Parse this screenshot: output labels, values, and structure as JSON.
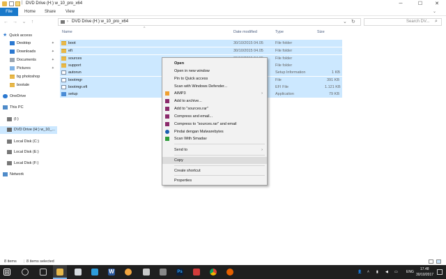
{
  "window": {
    "title": "DVD Drive (H:) w_10_pro_x64",
    "title_prefix": "|",
    "controls": [
      "─",
      "☐",
      "✕"
    ]
  },
  "ribbon": {
    "file_tab": "File",
    "tabs": [
      "Home",
      "Share",
      "View"
    ]
  },
  "address": {
    "path": "DVD Drive (H:) w_10_pro_x64",
    "search_placeholder": "Search DV..."
  },
  "nav": {
    "items": [
      {
        "label": "Quick access"
      },
      {
        "label": "Desktop",
        "pinned": true
      },
      {
        "label": "Downloads",
        "pinned": true
      },
      {
        "label": "Documents",
        "pinned": true
      },
      {
        "label": "Pictures",
        "pinned": true
      },
      {
        "label": "bg photoshop"
      },
      {
        "label": "bootale"
      },
      {
        "label": "OneDrive"
      },
      {
        "label": "This PC"
      },
      {
        "label": "(I:)"
      },
      {
        "label": "DVD Drive (H:) w_10_..."
      },
      {
        "label": "Local Disk (C:)"
      },
      {
        "label": "Local Disk (E:)"
      },
      {
        "label": "Local Disk (F:)"
      },
      {
        "label": "Network"
      }
    ]
  },
  "columns": {
    "name": "Name",
    "date": "Date modified",
    "type": "Type",
    "size": "Size"
  },
  "files": [
    {
      "name": "boot",
      "date": "30/10/2015 04.05",
      "type": "File folder",
      "size": "",
      "kind": "folder"
    },
    {
      "name": "efi",
      "date": "30/10/2015 04.05",
      "type": "File folder",
      "size": "",
      "kind": "folder"
    },
    {
      "name": "sources",
      "date": "30/10/2015 04.05",
      "type": "File folder",
      "size": "",
      "kind": "folder"
    },
    {
      "name": "support",
      "date": "",
      "type": "File folder",
      "size": "",
      "kind": "folder"
    },
    {
      "name": "autorun",
      "date": "",
      "type": "Setup Information",
      "size": "1 KB",
      "kind": "doc"
    },
    {
      "name": "bootmgr",
      "date": "",
      "type": "File",
      "size": "391 KB",
      "kind": "doc"
    },
    {
      "name": "bootmgr.efi",
      "date": "",
      "type": "EFI File",
      "size": "1.121 KB",
      "kind": "doc"
    },
    {
      "name": "setup",
      "date": "",
      "type": "Application",
      "size": "79 KB",
      "kind": "app"
    }
  ],
  "context_menu": {
    "items": [
      {
        "label": "Open",
        "bold": true
      },
      {
        "label": "Open in new window"
      },
      {
        "label": "Pin to Quick access"
      },
      {
        "label": "Scan with Windows Defender..."
      },
      {
        "label": "AIMP3",
        "submenu": true,
        "icon": "aimp-icon"
      },
      {
        "label": "Add to archive...",
        "icon": "winrar-icon"
      },
      {
        "label": "Add to \"sources.rar\"",
        "icon": "winrar-icon"
      },
      {
        "label": "Compress and email...",
        "icon": "winrar-icon"
      },
      {
        "label": "Compress to \"sources.rar\" and email",
        "icon": "winrar-icon"
      },
      {
        "label": "Pindai dengan Malwarebytes",
        "icon": "malwarebytes-icon"
      },
      {
        "label": "Scan With Smadav",
        "icon": "smadav-icon"
      },
      {
        "label": "Send to",
        "submenu": true
      },
      {
        "label": "Copy",
        "highlighted": true
      },
      {
        "label": "Create shortcut"
      },
      {
        "label": "Properties"
      }
    ]
  },
  "status": {
    "count": "8 items",
    "selected": "8 items selected"
  },
  "taskbar": {
    "apps": [
      "start-icon",
      "search-icon",
      "file-explorer-icon",
      "app-icon",
      "word-icon",
      "paint-icon",
      "app-icon-2",
      "photoshop-icon",
      "app-icon-3",
      "chrome-icon",
      "firefox-icon"
    ],
    "lang": "ENG",
    "time": "17.48",
    "date": "30/10/2017"
  },
  "colors": {
    "accent": "#1979ca",
    "selection": "#cce8ff",
    "taskbar": "#1f1f1f"
  }
}
